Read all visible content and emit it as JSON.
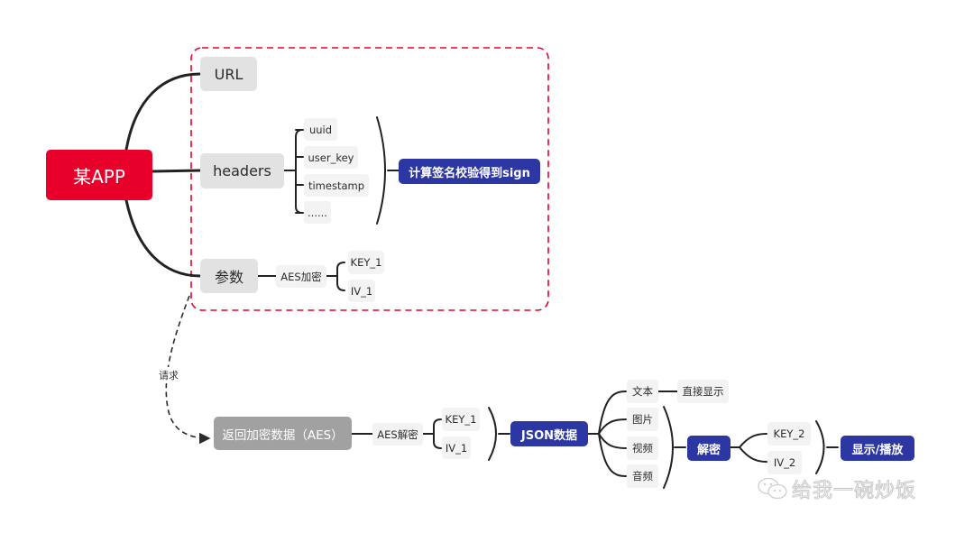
{
  "root": {
    "label": "某APP",
    "color": "#e8002a"
  },
  "request_group": {
    "border_color": "#e8002a",
    "url": "URL",
    "headers": {
      "label": "headers",
      "fields": [
        "uuid",
        "user_key",
        "timestamp",
        "......"
      ],
      "summary": "计算签名校验得到sign"
    },
    "params": {
      "label": "参数",
      "encryption": "AES加密",
      "keys": [
        "KEY_1",
        "IV_1"
      ]
    }
  },
  "request_edge_label": "请求",
  "response": {
    "label": "返回加密数据（AES）",
    "decryption": "AES解密",
    "keys": [
      "KEY_1",
      "IV_1"
    ],
    "result": "JSON数据",
    "types": {
      "text": {
        "label": "文本",
        "action": "直接显示"
      },
      "media": [
        "图片",
        "视频",
        "音频"
      ],
      "media_action": "解密",
      "media_keys": [
        "KEY_2",
        "IV_2"
      ],
      "final": "显示/播放"
    }
  },
  "colors": {
    "accent_blue": "#2c37a3",
    "node_grey": "#e2e2e2",
    "response_grey": "#a1a1a1"
  },
  "watermark": {
    "icon": "wechat-icon",
    "text": "给我一碗炒饭"
  }
}
